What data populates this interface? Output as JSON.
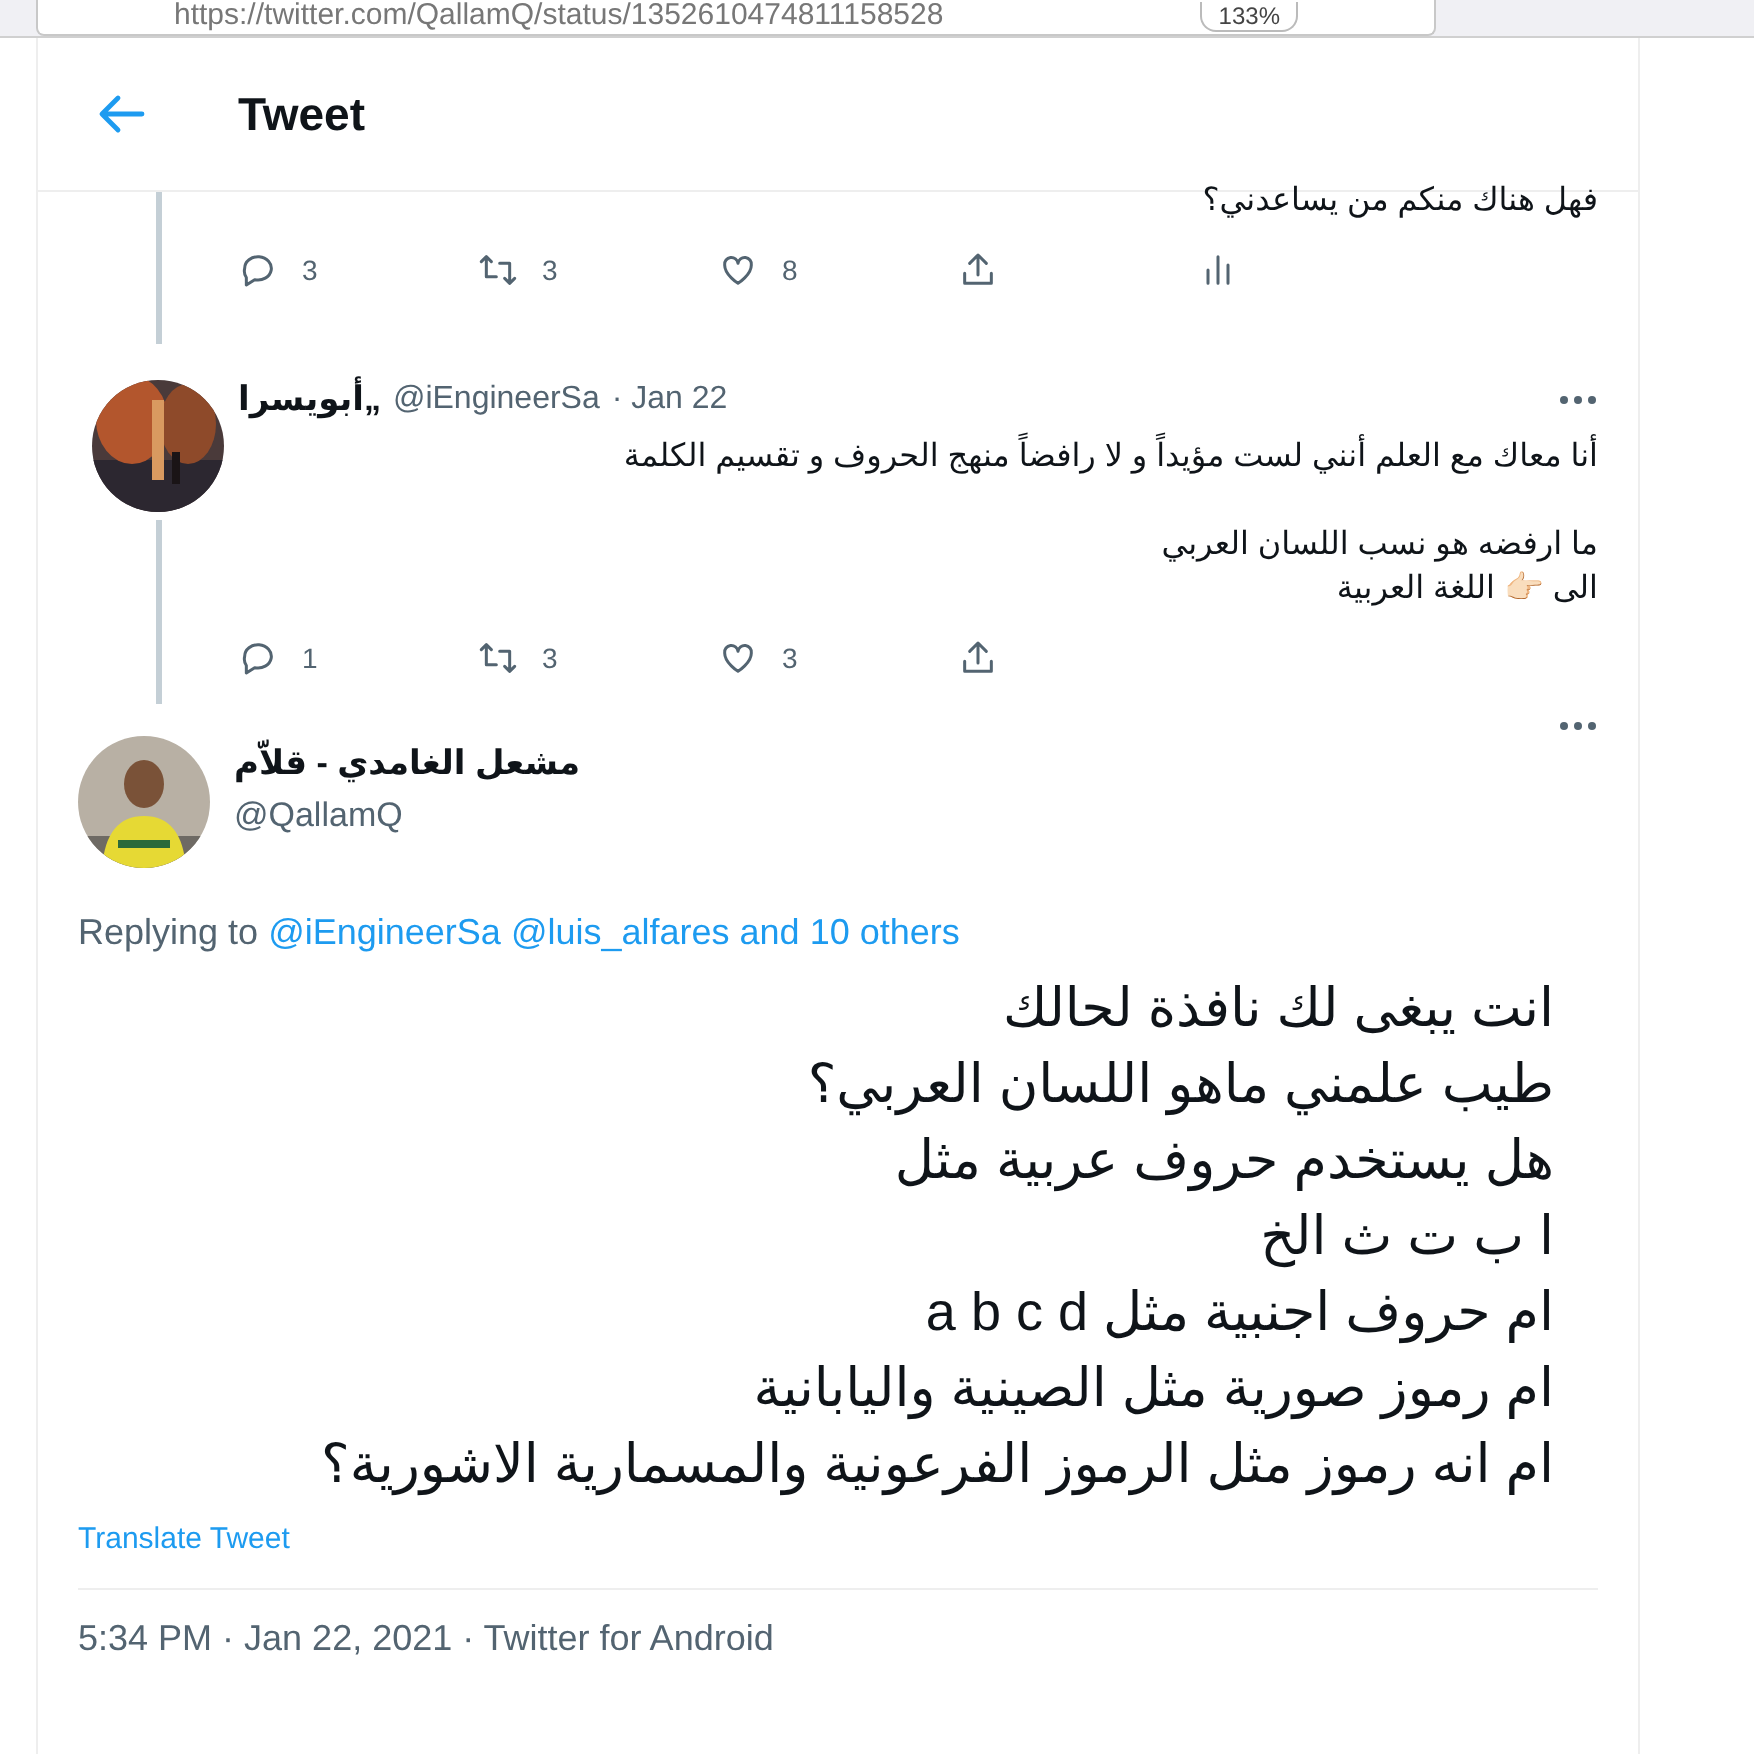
{
  "browser": {
    "url": "https://twitter.com/QallamQ/status/1352610474811158528",
    "zoom": "133%"
  },
  "header": {
    "title": "Tweet"
  },
  "thread": [
    {
      "kind": "partial",
      "text": "فهل هناك منكم من يساعدني؟",
      "actions": {
        "reply_count": "3",
        "retweet_count": "3",
        "like_count": "8",
        "analytics": true
      }
    },
    {
      "kind": "reply",
      "name": "أبويسرا„",
      "handle": "@iEngineerSa",
      "date": "· Jan 22",
      "paragraphs": [
        [
          "أنا معاك مع العلم أنني لست مؤيداً و لا رافضاً منهج الحروف و تقسيم الكلمة"
        ],
        [
          "ما ارفضه هو نسب اللسان العربي",
          "الى 👉🏻 اللغة العربية"
        ]
      ],
      "actions": {
        "reply_count": "1",
        "retweet_count": "3",
        "like_count": "3",
        "analytics": false
      }
    }
  ],
  "main": {
    "name": "مشعل الغامدي - قلاّم",
    "handle": "@QallamQ",
    "replying": {
      "prefix": "Replying to",
      "first_mention": "@iEngineerSa",
      "second_mention": "@luis_alfares",
      "others": "and 10 others"
    },
    "lines": [
      "انت يبغى لك نافذة لحالك",
      "طيب علمني ماهو اللسان العربي؟",
      "هل يستخدم حروف عربية مثل",
      "ا ب ت ث الخ",
      "ام حروف اجنبية مثل a b c d",
      "ام رموز صورية مثل الصينية واليابانية",
      "ام انه رموز مثل الرموز الفرعونية والمسمارية الاشورية؟"
    ],
    "translate": "Translate Tweet",
    "timestamp": "5:34 PM · Jan 22, 2021 · Twitter for Android"
  }
}
